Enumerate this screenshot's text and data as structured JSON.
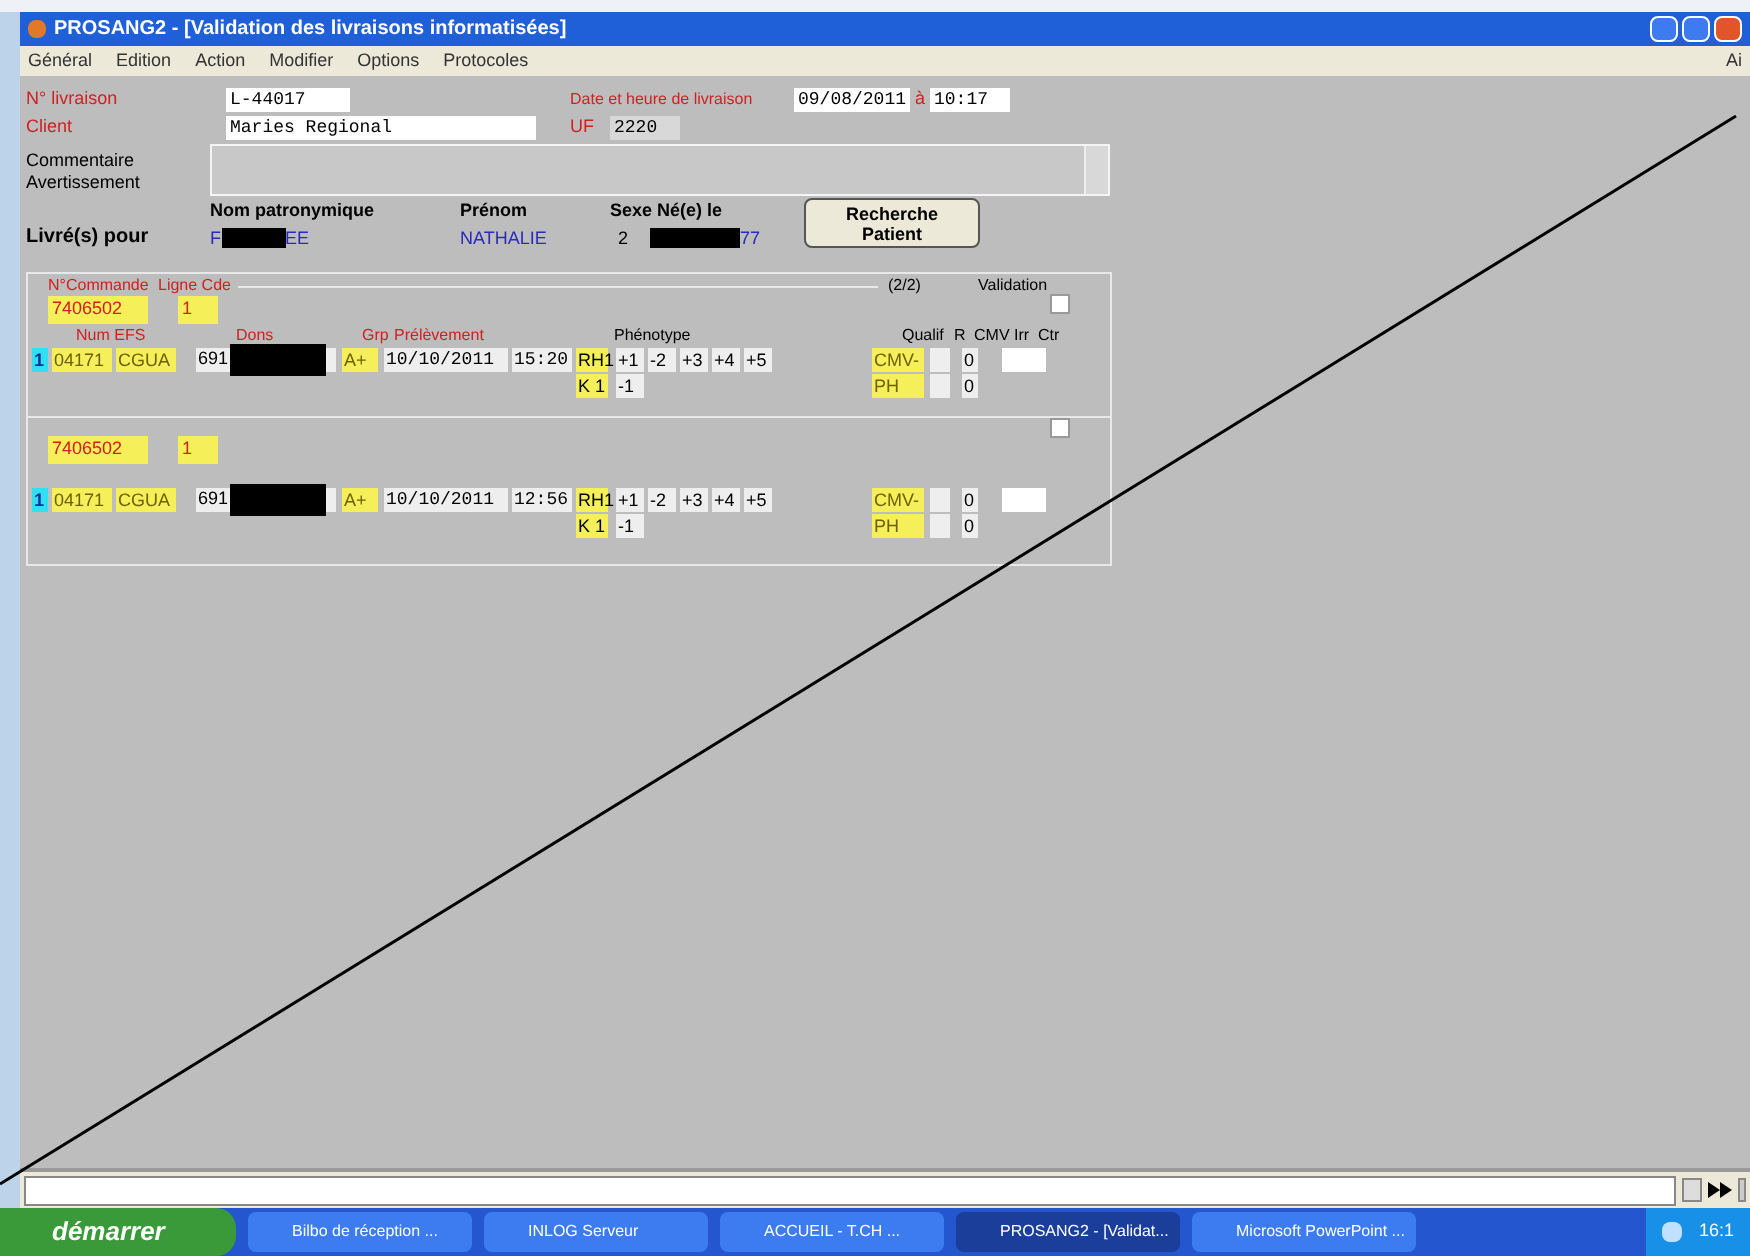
{
  "window": {
    "title": "PROSANG2 - [Validation des livraisons informatisées]"
  },
  "menu": [
    "Général",
    "Edition",
    "Action",
    "Modifier",
    "Options",
    "Protocoles"
  ],
  "menu_right": "Ai",
  "header": {
    "delivery_number": {
      "label": "N° livraison",
      "value": "L-44017"
    },
    "date": {
      "label": "Date et heure de livraison",
      "date": "09/08/2011",
      "at": "à",
      "time": "10:17"
    },
    "client": {
      "label": "Client",
      "value": "Maries Regional"
    },
    "uf": {
      "label": "UF",
      "value": "2220"
    },
    "comment_labels": [
      "Commentaire",
      "Avertissement"
    ]
  },
  "patient": {
    "label": "Livré(s) pour",
    "columns": [
      "Nom patronymique",
      "Prénom",
      "Sexe Né(e) le"
    ],
    "surname_start": "F",
    "surname_end": "EE",
    "first_name": "NATHALIE",
    "sex": "2",
    "birth_end": "77",
    "search_button": "Recherche Patient"
  },
  "orders": {
    "order_header": "N°Commande",
    "line_header": "Ligne Cde",
    "counter": "(2/2)",
    "validation": "Validation",
    "column_headers": [
      "Num EFS",
      "Dons",
      "Grp",
      "Prélèvement",
      "Phénotype",
      "Qualif",
      "R",
      "CMV",
      "Irr",
      "Ctr"
    ],
    "blocks": [
      {
        "order": "7406502",
        "line": "1",
        "validated": false,
        "product": {
          "index": "1",
          "efs": "04171",
          "code": "CGUA",
          "don": "691",
          "group": "A+",
          "date": "10/10/2011",
          "time": "15:20",
          "phenotype": [
            [
              "RH1",
              "+1",
              "-2",
              "+3",
              "+4",
              "+5"
            ],
            [
              "K 1",
              "-1"
            ]
          ],
          "qualif": [
            "CMV-",
            "PH"
          ],
          "cmv": [
            "0",
            "0"
          ]
        }
      },
      {
        "order": "7406502",
        "line": "1",
        "validated": false,
        "product": {
          "index": "1",
          "efs": "04171",
          "code": "CGUA",
          "don": "691",
          "group": "A+",
          "date": "10/10/2011",
          "time": "12:56",
          "phenotype": [
            [
              "RH1",
              "+1",
              "-2",
              "+3",
              "+4",
              "+5"
            ],
            [
              "K 1",
              "-1"
            ]
          ],
          "qualif": [
            "CMV-",
            "PH"
          ],
          "cmv": [
            "0",
            "0"
          ]
        }
      }
    ]
  },
  "taskbar": {
    "start": "démarrer",
    "items": [
      {
        "label": "Bilbo de réception ...",
        "selected": false
      },
      {
        "label": "INLOG Serveur",
        "selected": false
      },
      {
        "label": "ACCUEIL - T.CH ...",
        "selected": false
      },
      {
        "label": "PROSANG2 - [Validat...",
        "selected": true
      },
      {
        "label": "Microsoft PowerPoint ...",
        "selected": false
      }
    ],
    "clock": "16:1"
  }
}
